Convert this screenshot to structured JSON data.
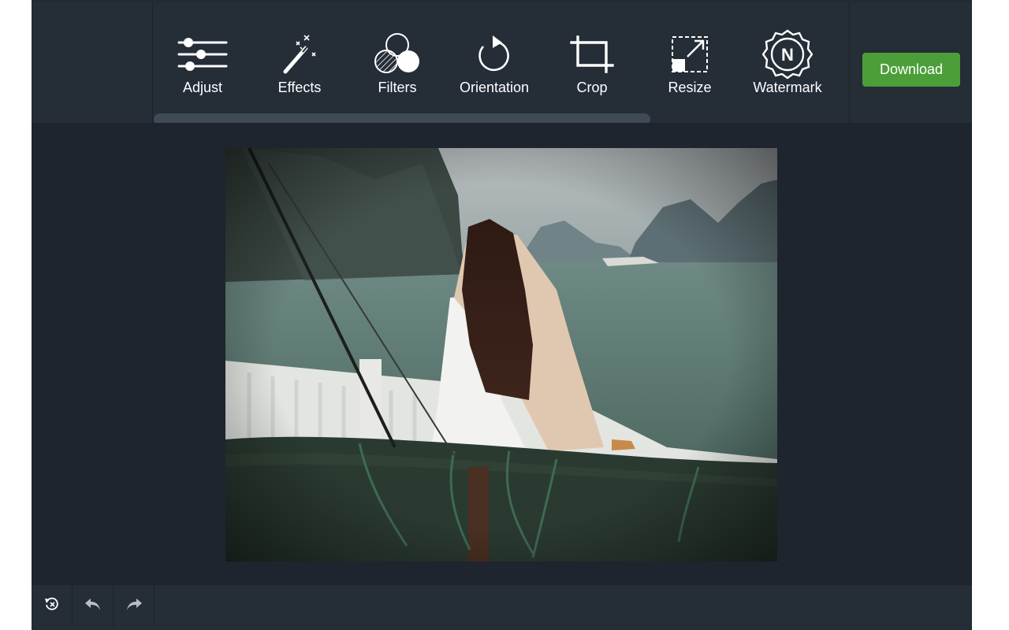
{
  "toolbar": {
    "tools": [
      {
        "label": "Adjust",
        "icon": "sliders-icon"
      },
      {
        "label": "Effects",
        "icon": "magic-wand-icon"
      },
      {
        "label": "Filters",
        "icon": "filters-circles-icon"
      },
      {
        "label": "Orientation",
        "icon": "rotate-icon"
      },
      {
        "label": "Crop",
        "icon": "crop-icon"
      },
      {
        "label": "Resize",
        "icon": "resize-icon"
      },
      {
        "label": "Watermark",
        "icon": "watermark-badge-icon"
      }
    ],
    "watermark_badge_letter": "N",
    "download_label": "Download"
  },
  "bottombar": {
    "buttons": [
      {
        "icon": "reset-icon"
      },
      {
        "icon": "undo-icon"
      },
      {
        "icon": "redo-icon"
      }
    ]
  },
  "colors": {
    "accent": "#4c9f38",
    "toolbar_bg": "#252d37",
    "canvas_bg": "#1e252e"
  }
}
